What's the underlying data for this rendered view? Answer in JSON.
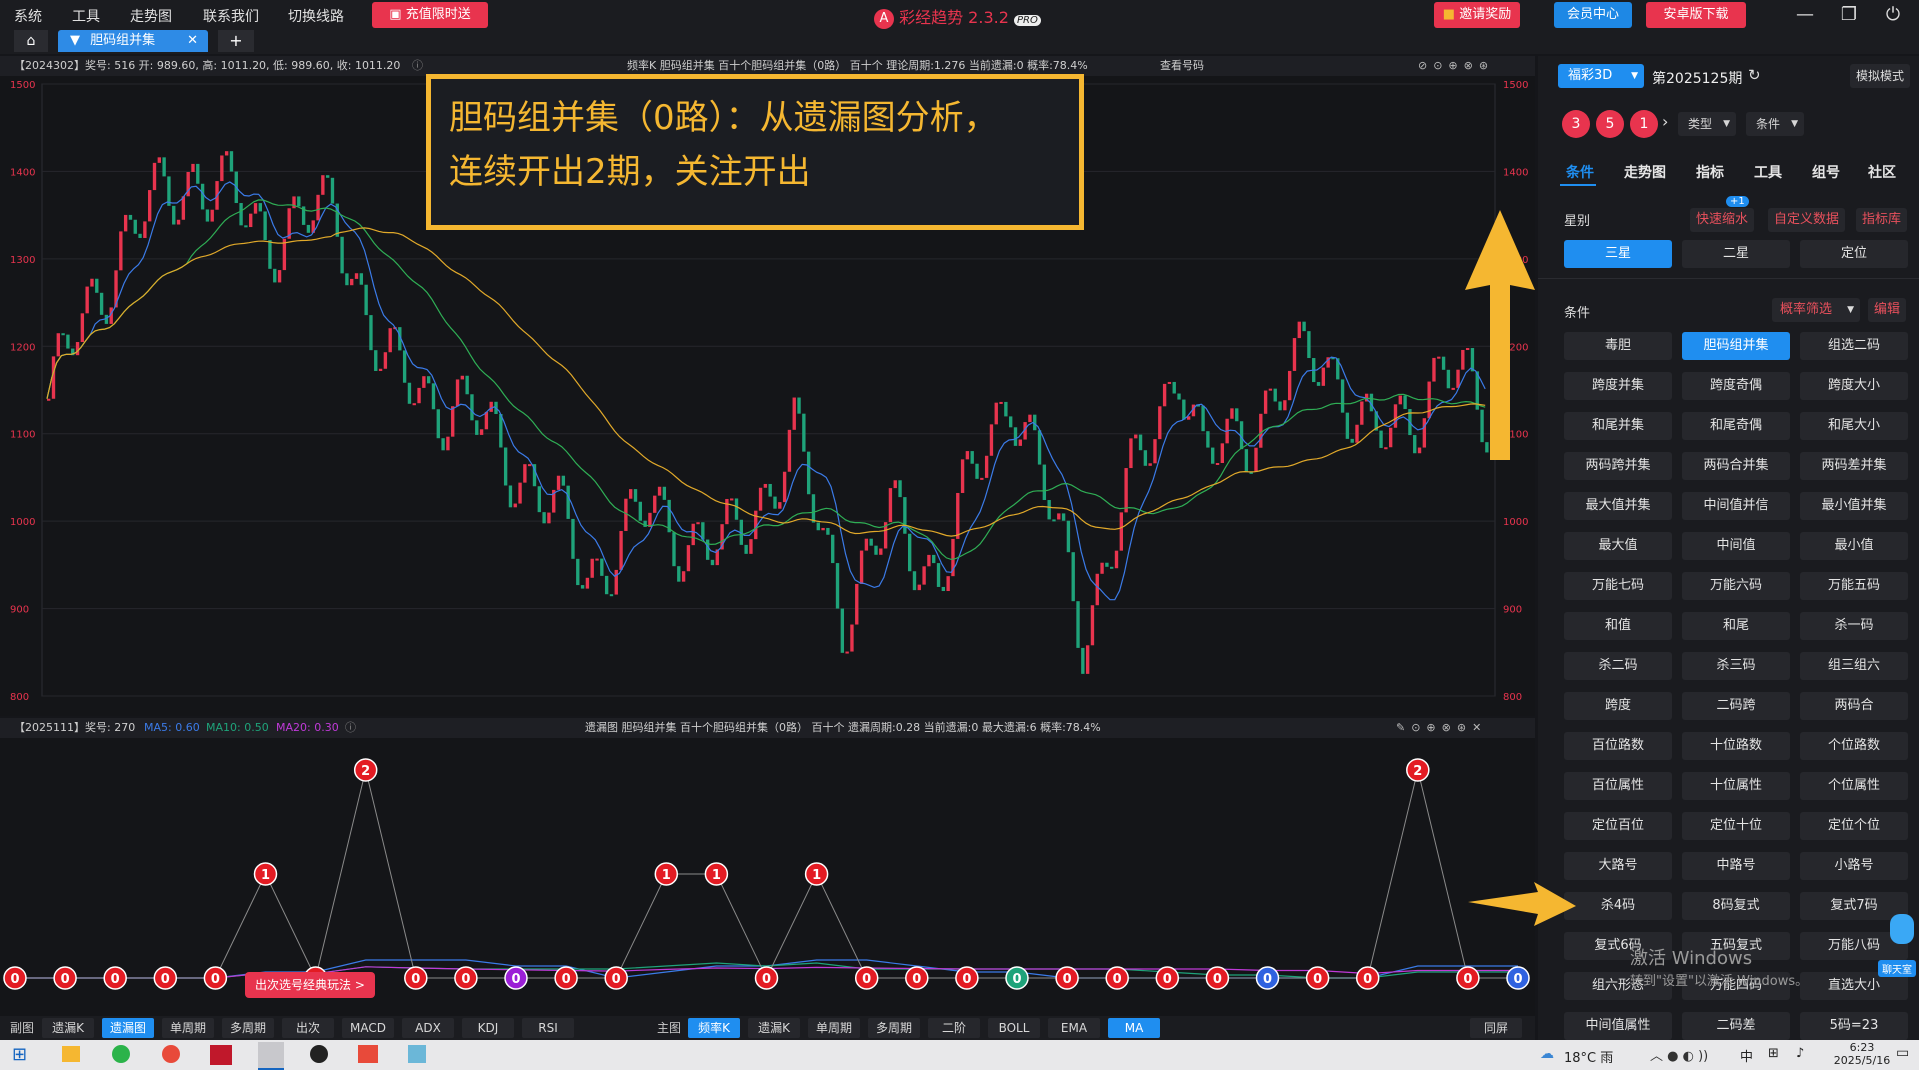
{
  "menu": [
    "系统",
    "工具",
    "走势图",
    "联系我们",
    "切换线路"
  ],
  "promo_label": "充值限时送",
  "app_title": "彩经趋势 2.3.2",
  "app_badge": "PRO",
  "header_buttons": {
    "invite": "邀请奖励",
    "member": "会员中心",
    "android": "安卓版下载"
  },
  "tab": {
    "label": "胆码组并集",
    "add": "+"
  },
  "kchart": {
    "head_left": "【2024302】奖号: 516  开: 989.60, 高: 1011.20, 低: 989.60, 收: 1011.20",
    "head_center": "频率K  胆码组并集  百十个胆码组并集（0路）  百十个  理论周期:1.276  当前遗漏:0  概率:78.4%",
    "head_query": "查看号码",
    "y_ticks": [
      "1500",
      "1400",
      "1300",
      "1200",
      "1100",
      "1000",
      "900",
      "800"
    ]
  },
  "callout": {
    "line1": "胆码组并集（0路）：从遗漏图分析，",
    "line2": "连续开出2期，关注开出"
  },
  "omit": {
    "head_left": "【2025111】奖号: 270",
    "ma5": "MA5: 0.60",
    "ma10": "MA10: 0.50",
    "ma20": "MA20: 0.30",
    "head_center": "遗漏图  胆码组并集  百十个胆码组并集（0路）  百十个  遗漏周期:0.28  当前遗漏:0  最大遗漏:6  概率:78.4%",
    "values": [
      0,
      0,
      0,
      0,
      0,
      1,
      0,
      2,
      0,
      0,
      0,
      0,
      0,
      1,
      1,
      0,
      1,
      0,
      0,
      0,
      0,
      0,
      0,
      0,
      0,
      0,
      0,
      0,
      2,
      0,
      0
    ],
    "purple_index": 10,
    "green_index": 20,
    "blue_indices": [
      25,
      30
    ],
    "tooltip": "出次选号经典玩法 >"
  },
  "bottom_left": {
    "label": "副图",
    "tabs": [
      "遗漏K",
      "遗漏图",
      "单周期",
      "多周期",
      "出次",
      "MACD",
      "ADX",
      "KDJ",
      "RSI"
    ],
    "active": "遗漏图"
  },
  "bottom_right": {
    "label": "主图",
    "tabs": [
      "频率K",
      "遗漏K",
      "单周期",
      "多周期",
      "二阶",
      "BOLL",
      "EMA",
      "MA"
    ],
    "active": [
      "频率K",
      "MA"
    ],
    "end": "同屏"
  },
  "right": {
    "lottery": "福彩3D",
    "period": "第2025125期",
    "sim_mode": "模拟模式",
    "balls": [
      "3",
      "5",
      "1"
    ],
    "filter_type": "类型",
    "filter_cond": "条件",
    "tabs": [
      "条件",
      "走势图",
      "指标",
      "工具",
      "组号",
      "社区"
    ],
    "star_label": "星别",
    "star_links": [
      "快速缩水",
      "自定义数据",
      "指标库"
    ],
    "star_badge": "+1",
    "stars": [
      "三星",
      "二星",
      "定位"
    ],
    "cond_label": "条件",
    "cond_filter": "概率筛选",
    "cond_edit": "编辑",
    "conditions": [
      "毒胆",
      "胆码组并集",
      "组选二码",
      "跨度并集",
      "跨度奇偶",
      "跨度大小",
      "和尾并集",
      "和尾奇偶",
      "和尾大小",
      "两码跨并集",
      "两码合并集",
      "两码差并集",
      "最大值并集",
      "中间值并信",
      "最小值并集",
      "最大值",
      "中间值",
      "最小值",
      "万能七码",
      "万能六码",
      "万能五码",
      "和值",
      "和尾",
      "杀一码",
      "杀二码",
      "杀三码",
      "组三组六",
      "跨度",
      "二码跨",
      "两码合",
      "百位路数",
      "十位路数",
      "个位路数",
      "百位属性",
      "十位属性",
      "个位属性",
      "定位百位",
      "定位十位",
      "定位个位",
      "大路号",
      "中路号",
      "小路号",
      "杀4码",
      "8码复式",
      "复式7码",
      "复式6码",
      "五码复式",
      "万能八码",
      "组六形态",
      "万能四码",
      "直选大小",
      "中间值属性",
      "二码差",
      "5码=23"
    ],
    "active_condition": "胆码组并集",
    "chat_label": "聊天室"
  },
  "watermark": {
    "line1": "激活 Windows",
    "line2": "转到\"设置\"以激活 Windows。"
  },
  "taskbar": {
    "weather": "18°C 雨",
    "ime": "中",
    "time": "6:23",
    "date": "2025/5/16"
  },
  "colors": {
    "accent": "#1f8ef0",
    "up": "#e8344e",
    "down": "#1fa37a",
    "callout": "#f5b731"
  }
}
